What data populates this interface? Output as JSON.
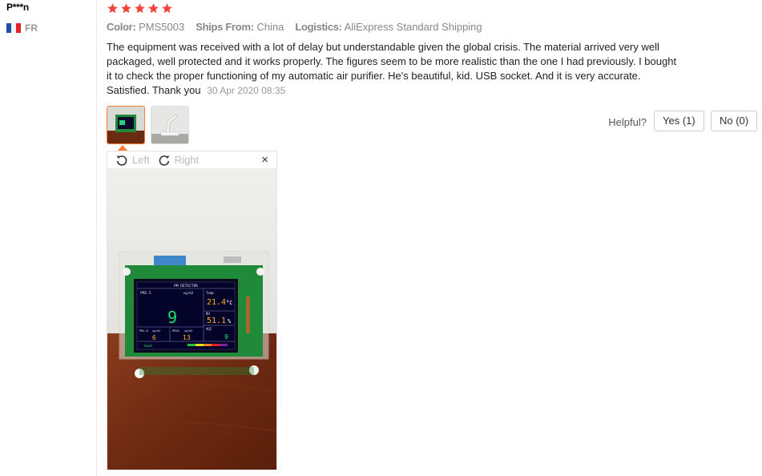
{
  "user": {
    "name": "P***n",
    "country_code": "FR"
  },
  "rating": {
    "stars": 5,
    "color": "#f5423b"
  },
  "meta": [
    {
      "key": "Color:",
      "value": "PMS5003"
    },
    {
      "key": "Ships From:",
      "value": "China"
    },
    {
      "key": "Logistics:",
      "value": "AliExpress Standard Shipping"
    }
  ],
  "review": {
    "text": "The equipment was received with a lot of delay but understandable given the global crisis. The material arrived very well packaged, well protected and it works properly. The figures seem to be more realistic than the one I had previously. I bought it to check the proper functioning of my automatic air purifier. He's beautiful, kid. USB socket. And it is very accurate. Satisfied. Thank you",
    "date": "30 Apr 2020 08:35"
  },
  "helpful": {
    "label": "Helpful?",
    "yes_label": "Yes (1)",
    "no_label": "No (0)"
  },
  "viewer": {
    "rotate_left": "Left",
    "rotate_right": "Right",
    "close": "×"
  },
  "screen": {
    "title": "PM DETECTOR",
    "pm25_label": "PM2.5",
    "pm25_unit": "ug/m3",
    "pm25_value": "9",
    "temp_label": "Temp",
    "temp_value": "21.4",
    "temp_unit": "°C",
    "rh_label": "RH",
    "rh_value": "51.1",
    "rh_unit": "%",
    "pm10_label": "PM1.0",
    "pm10_unit": "ug/m3",
    "pm10_value": "6",
    "pm100_label": "PM10",
    "pm100_unit": "ug/m3",
    "pm100_value": "13",
    "aqi_label": "AQI",
    "aqi_value": "9",
    "status": "Good"
  },
  "colors": {
    "accent": "#ff7a33",
    "flag_blue": "#1d4ea8",
    "flag_red": "#e02424"
  }
}
